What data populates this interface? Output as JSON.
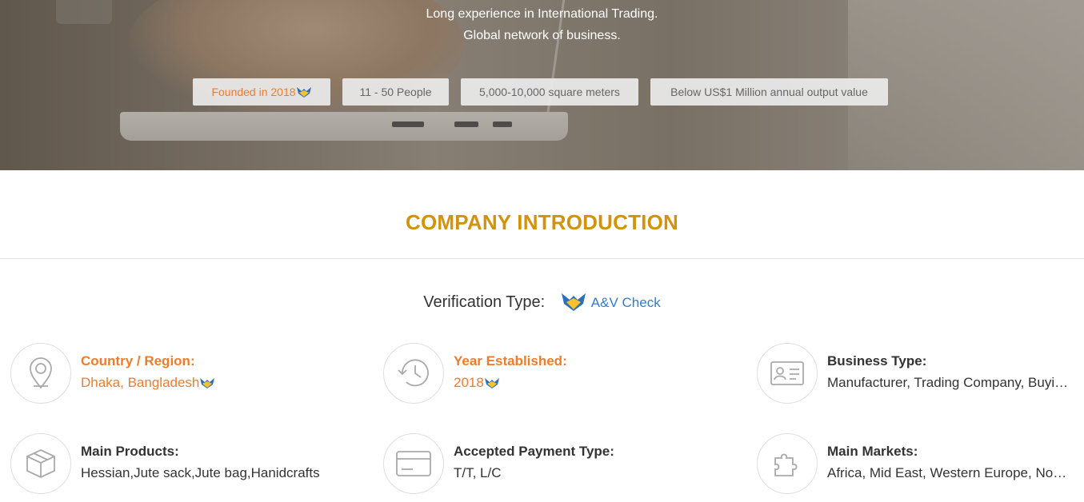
{
  "hero": {
    "line1": "Long experience in International Trading.",
    "line2": "Global network of business.",
    "tags": {
      "founded": "Founded in 2018",
      "people": "11 - 50 People",
      "area": "5,000-10,000 square meters",
      "output": "Below US$1 Million annual output value"
    }
  },
  "section": {
    "title": "COMPANY INTRODUCTION"
  },
  "verification": {
    "label": "Verification Type:",
    "link": "A&V Check"
  },
  "info": {
    "country": {
      "label": "Country / Region:",
      "value": "Dhaka, Bangladesh",
      "icon": "location-pin-icon"
    },
    "year": {
      "label": "Year Established:",
      "value": "2018",
      "icon": "history-clock-icon"
    },
    "business": {
      "label": "Business Type:",
      "value": "Manufacturer, Trading Company, Buying Office",
      "icon": "id-card-icon"
    },
    "products": {
      "label": "Main Products:",
      "value": "Hessian,Jute sack,Jute bag,Hanidcrafts",
      "icon": "box-icon"
    },
    "payment": {
      "label": "Accepted Payment Type:",
      "value": "T/T, L/C",
      "icon": "credit-card-icon"
    },
    "markets": {
      "label": "Main Markets:",
      "value": "Africa, Mid East, Western Europe, North America",
      "icon": "puzzle-icon"
    }
  },
  "colors": {
    "accent_orange": "#f07c2a",
    "title_gold": "#d4920a",
    "link_blue": "#2f7bd4"
  }
}
